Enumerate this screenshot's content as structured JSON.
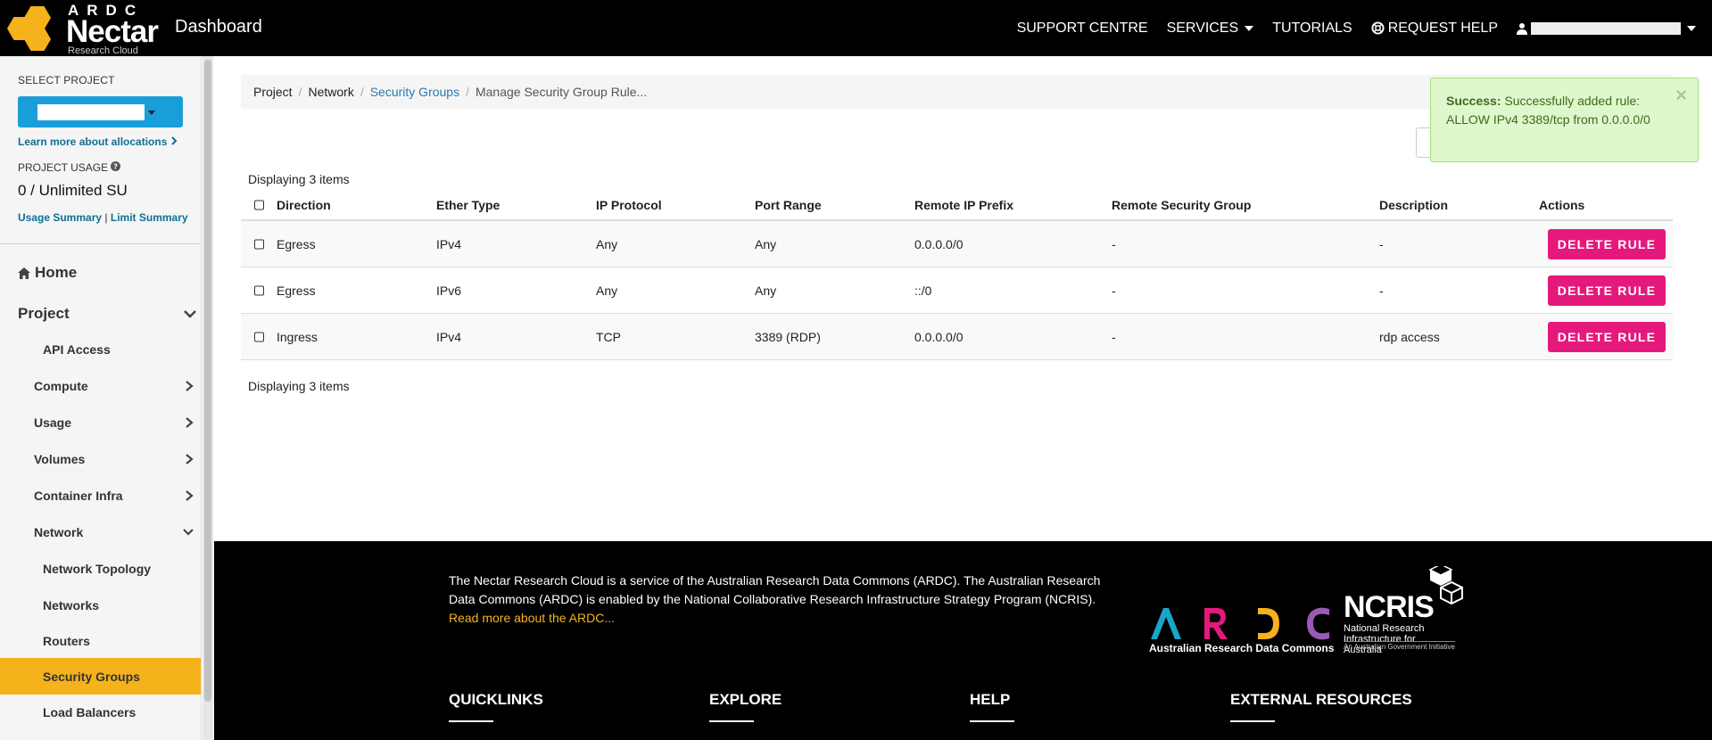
{
  "brand": {
    "ardc": "ARDC",
    "nectar": "Nectar",
    "research_cloud": "Research Cloud",
    "dashboard": "Dashboard"
  },
  "topnav": {
    "support": "SUPPORT CENTRE",
    "services": "SERVICES",
    "tutorials": "TUTORIALS",
    "request_help": "REQUEST HELP"
  },
  "sidebar": {
    "select_project": "SELECT PROJECT",
    "learn_more": "Learn more about allocations",
    "project_usage": "PROJECT USAGE",
    "usage_value": "0 / Unlimited SU",
    "usage_summary": "Usage Summary",
    "limit_summary": "Limit Summary",
    "link_separator": "|",
    "home": "Home",
    "project": "Project",
    "api_access": "API Access",
    "compute": "Compute",
    "usage": "Usage",
    "volumes": "Volumes",
    "container_infra": "Container Infra",
    "network": "Network",
    "network_topology": "Network Topology",
    "networks": "Networks",
    "routers": "Routers",
    "security_groups": "Security Groups",
    "load_balancers": "Load Balancers"
  },
  "breadcrumb": {
    "project": "Project",
    "network": "Network",
    "security_groups": "Security Groups",
    "current": "Manage Security Group Rule..."
  },
  "table": {
    "count_label": "Displaying 3 items",
    "headers": [
      "Direction",
      "Ether Type",
      "IP Protocol",
      "Port Range",
      "Remote IP Prefix",
      "Remote Security Group",
      "Description",
      "Actions"
    ],
    "rows": [
      {
        "direction": "Egress",
        "ether": "IPv4",
        "protocol": "Any",
        "port": "Any",
        "prefix": "0.0.0.0/0",
        "group": "-",
        "description": "-",
        "action": "DELETE RULE"
      },
      {
        "direction": "Egress",
        "ether": "IPv6",
        "protocol": "Any",
        "port": "Any",
        "prefix": "::/0",
        "group": "-",
        "description": "-",
        "action": "DELETE RULE"
      },
      {
        "direction": "Ingress",
        "ether": "IPv4",
        "protocol": "TCP",
        "port": "3389 (RDP)",
        "prefix": "0.0.0.0/0",
        "group": "-",
        "description": "rdp access",
        "action": "DELETE RULE"
      }
    ]
  },
  "alert": {
    "title": "Success:",
    "message": "Successfully added rule: ALLOW IPv4 3389/tcp from 0.0.0.0/0",
    "close": "×"
  },
  "footer": {
    "text": "The Nectar Research Cloud is a service of the Australian Research Data Commons (ARDC). The Australian Research Data Commons (ARDC) is enabled by the National Collaborative Research Infrastructure Strategy Program (NCRIS).",
    "read_more": "Read more about the ARDC...",
    "ardc_caption": "Australian Research Data Commons",
    "ncris_title": "NCRIS",
    "ncris_sub": "National Research Infrastructure for Australia",
    "ncris_sub2": "An Australian Government Initiative",
    "headings": [
      "QUICKLINKS",
      "EXPLORE",
      "HELP",
      "EXTERNAL RESOURCES"
    ]
  },
  "colors": {
    "brand_yellow": "#f6b21b",
    "accent_blue": "#1a9ed9",
    "delete_pink": "#e5197c",
    "success_bg": "#dff7cc"
  }
}
